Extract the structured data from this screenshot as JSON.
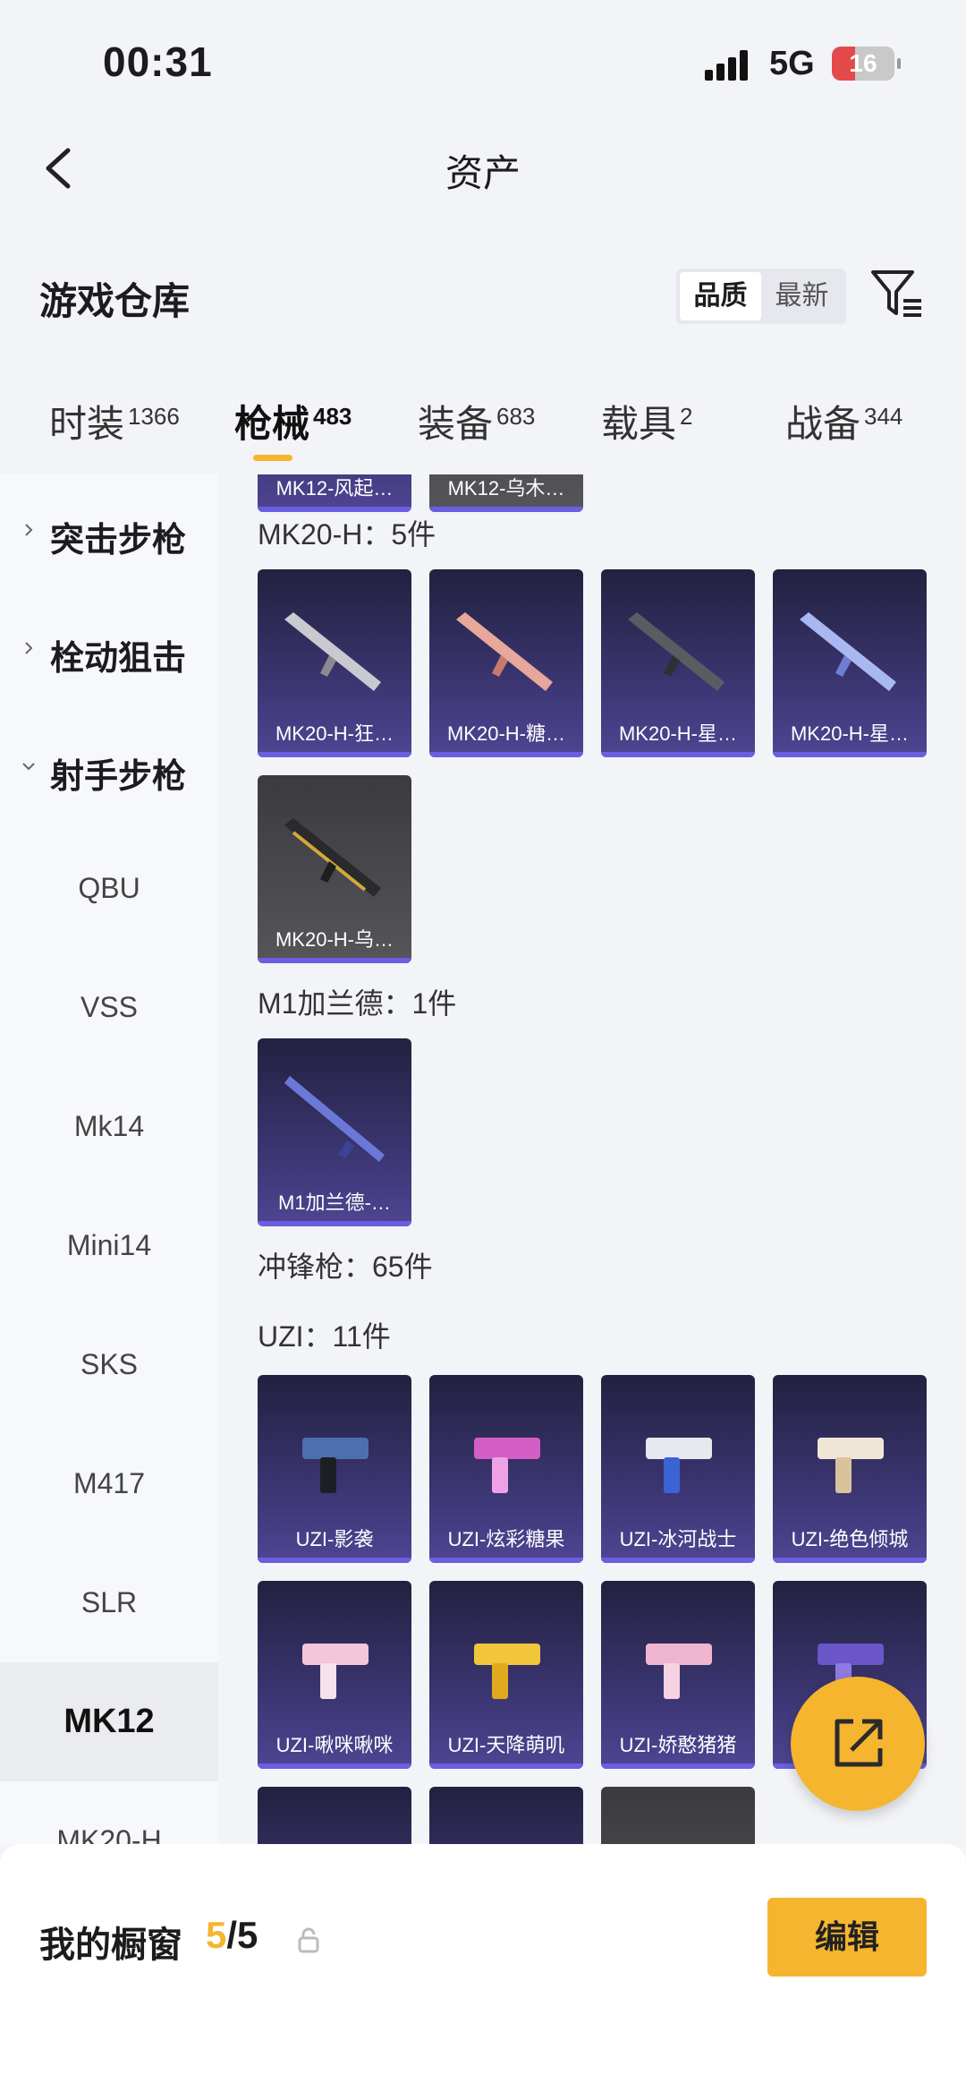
{
  "status_bar": {
    "time": "00:31",
    "network": "5G",
    "battery": "16",
    "battery_level": 0.16
  },
  "nav": {
    "title": "资产"
  },
  "warehouse": {
    "title": "游戏仓库",
    "sort": {
      "quality": "品质",
      "newest": "最新"
    }
  },
  "tabs": [
    {
      "label": "时装",
      "count": "1366"
    },
    {
      "label": "枪械",
      "count": "483"
    },
    {
      "label": "装备",
      "count": "683"
    },
    {
      "label": "载具",
      "count": "2"
    },
    {
      "label": "战备",
      "count": "344"
    }
  ],
  "sidebar": {
    "categories": [
      "突击步枪",
      "栓动狙击",
      "射手步枪"
    ],
    "subs": [
      "QBU",
      "VSS",
      "Mk14",
      "Mini14",
      "SKS",
      "M417",
      "SLR",
      "MK12",
      "MK20-H"
    ]
  },
  "groups": {
    "mk20": {
      "label": "MK20-H：5件",
      "items": [
        "MK20-H-狂…",
        "MK20-H-糖…",
        "MK20-H-星…",
        "MK20-H-星…",
        "MK20-H-乌…"
      ]
    },
    "m1": {
      "label": "M1加兰德：1件",
      "items": [
        "M1加兰德-…"
      ]
    },
    "smg": {
      "label": "冲锋枪：65件"
    },
    "uzi": {
      "label": "UZI：11件",
      "items": [
        "UZI-影袭",
        "UZI-炫彩糖果",
        "UZI-冰河战士",
        "UZI-绝色倾城",
        "UZI-啾咪啾咪",
        "UZI-天降萌叽",
        "UZI-娇憨猪猪"
      ]
    },
    "top_partial": [
      "MK12-风起…",
      "MK12-乌木…"
    ]
  },
  "bottom": {
    "label": "我的橱窗",
    "current": "5",
    "total": "/5",
    "edit": "编辑"
  },
  "colors": {
    "accent": "#f6b52f",
    "card_purple": "#3b3571",
    "card_grey": "#55555a"
  }
}
